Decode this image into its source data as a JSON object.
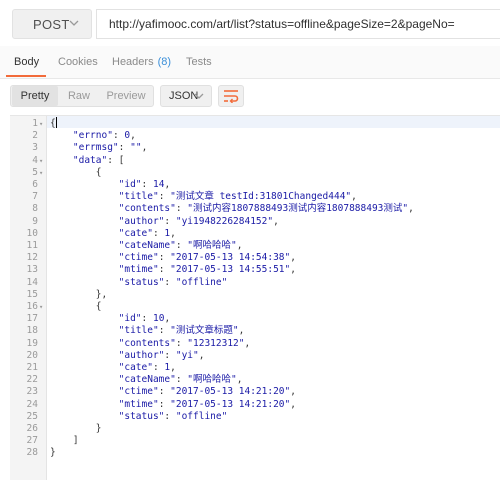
{
  "request": {
    "method": "POST",
    "url": "http://yafimooc.com/art/list?status=offline&pageSize=2&pageNo="
  },
  "tabs": [
    {
      "label": "Body",
      "active": true
    },
    {
      "label": "Cookies"
    },
    {
      "label": "Headers",
      "badge": "(8)"
    },
    {
      "label": "Tests"
    }
  ],
  "toolbar": {
    "view_modes": [
      "Pretty",
      "Raw",
      "Preview"
    ],
    "active_view": "Pretty",
    "format": "JSON"
  },
  "colors": {
    "accent": "#f26b3a",
    "badge": "#3b8fd9",
    "string": "#1a1aa6"
  },
  "lines": [
    "{",
    "    \"errno\": 0,",
    "    \"errmsg\": \"\",",
    "    \"data\": [",
    "        {",
    "            \"id\": 14,",
    "            \"title\": \"测试文章 testId:31801Changed444\",",
    "            \"contents\": \"测试内容1807888493测试内容1807888493测试\",",
    "            \"author\": \"yi1948226284152\",",
    "            \"cate\": 1,",
    "            \"cateName\": \"啊哈哈哈\",",
    "            \"ctime\": \"2017-05-13 14:54:38\",",
    "            \"mtime\": \"2017-05-13 14:55:51\",",
    "            \"status\": \"offline\"",
    "        },",
    "        {",
    "            \"id\": 10,",
    "            \"title\": \"测试文章标题\",",
    "            \"contents\": \"12312312\",",
    "            \"author\": \"yi\",",
    "            \"cate\": 1,",
    "            \"cateName\": \"啊哈哈哈\",",
    "            \"ctime\": \"2017-05-13 14:21:20\",",
    "            \"mtime\": \"2017-05-13 14:21:20\",",
    "            \"status\": \"offline\"",
    "        }",
    "    ]",
    "}"
  ],
  "foldable_lines": [
    1,
    4,
    5,
    16
  ]
}
